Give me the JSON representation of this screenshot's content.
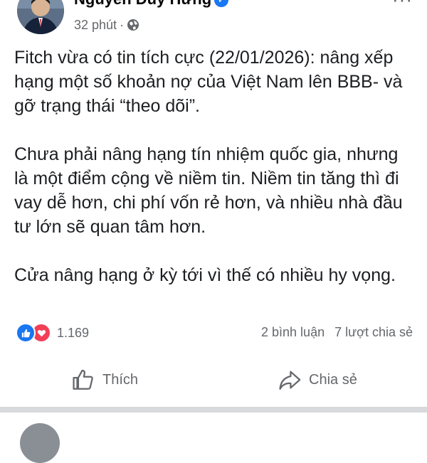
{
  "post": {
    "author": "Nguyễn Duy Hưng",
    "time": "32 phút",
    "separator": "·",
    "more": "···",
    "paragraphs": [
      "Fitch vừa có tin tích cực (22/01/2026): nâng xếp hạng một số khoản nợ của Việt Nam lên BBB- và gỡ trạng thái “theo dõi”.",
      "Chưa phải nâng hạng tín nhiệm quốc gia, nhưng là một điểm cộng về niềm tin. Niềm tin tăng thì đi vay dễ hơn, chi phí vốn rẻ hơn, và nhiều nhà đầu tư lớn sẽ quan tâm hơn.",
      "Cửa nâng hạng ở kỳ tới vì thế có nhiều hy vọng."
    ],
    "reaction_count": "1.169",
    "comments": "2 bình luận",
    "shares": "7 lượt chia sẻ",
    "actions": {
      "like": "Thích",
      "share": "Chia sẻ"
    }
  },
  "icons": {
    "verified": "verified-badge-icon",
    "audience": "globe-icon",
    "reaction_like": "like-reaction-icon",
    "reaction_love": "love-reaction-icon",
    "like_action": "thumbs-up-icon",
    "share_action": "share-arrow-icon"
  },
  "colors": {
    "verified": "#1877f2",
    "like": "#1877f2",
    "love": "#f33e58",
    "secondary_text": "#65676b",
    "divider": "#d7d9dd"
  }
}
